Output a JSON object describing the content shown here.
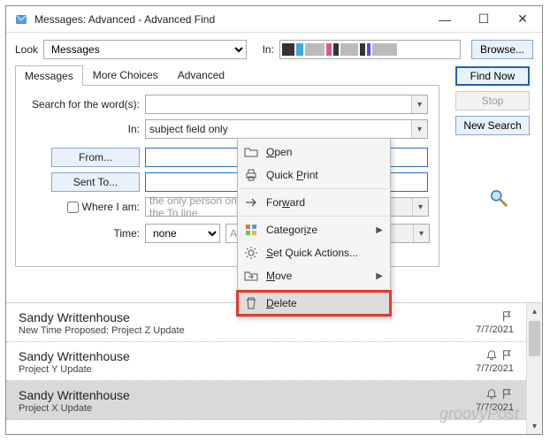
{
  "window": {
    "title": "Messages: Advanced - Advanced Find"
  },
  "toolbar": {
    "look_label": "Look",
    "look_value": "Messages",
    "in_label": "In:",
    "browse": "Browse..."
  },
  "tabs": {
    "messages": "Messages",
    "more": "More Choices",
    "advanced": "Advanced"
  },
  "side": {
    "find": "Find Now",
    "stop": "Stop",
    "new_search": "New Search"
  },
  "form": {
    "search_label": "Search for the word(s):",
    "in_label": "In:",
    "in_value": "subject field only",
    "from": "From...",
    "sent_to": "Sent To...",
    "where": "Where I am:",
    "where_value": "the only person on the To line",
    "time_label": "Time:",
    "time_value": "none",
    "anytime": "Anytime"
  },
  "context": {
    "open": "Open",
    "quick_print": "Quick Print",
    "forward": "Forward",
    "categorize": "Categorize",
    "set_quick": "Set Quick Actions...",
    "move": "Move",
    "delete": "Delete"
  },
  "results": [
    {
      "name": "Sandy Writtenhouse",
      "subject": "New Time Proposed: Project Z Update",
      "date": "7/7/2021",
      "icons": [
        "flag-icon"
      ]
    },
    {
      "name": "Sandy Writtenhouse",
      "subject": "Project Y Update",
      "date": "7/7/2021",
      "icons": [
        "bell-icon",
        "flag-icon"
      ]
    },
    {
      "name": "Sandy Writtenhouse",
      "subject": "Project X Update",
      "date": "7/7/2021",
      "icons": [
        "bell-icon",
        "flag-icon"
      ]
    }
  ],
  "watermark": "groovyPost"
}
